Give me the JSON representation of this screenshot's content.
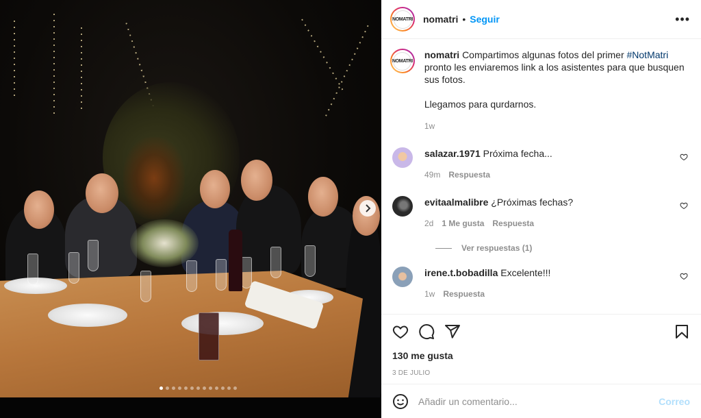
{
  "header": {
    "username": "nomatri",
    "separator": "•",
    "follow_label": "Seguir",
    "more_label": "•••",
    "avatar_text": "NOMATRI"
  },
  "caption": {
    "username": "nomatri",
    "text_before": "Compartimos algunas fotos del primer",
    "hashtag": "#NotMatri",
    "text_after": "pronto les enviaremos link a los asistentes para que busquen sus fotos.",
    "line2": "Llegamos para qurdarnos.",
    "time": "1w"
  },
  "comments": [
    {
      "username": "salazar.1971",
      "text": "Próxima fecha...",
      "time": "49m",
      "likes": "",
      "reply": "Respuesta",
      "avatar_color": "#c9b8e8"
    },
    {
      "username": "evitaalmalibre",
      "text": "¿Próximas fechas?",
      "time": "2d",
      "likes": "1 Me gusta",
      "reply": "Respuesta",
      "avatar_color": "#3a3a3a"
    },
    {
      "username": "irene.t.bobadilla",
      "text": "Excelente!!!",
      "time": "1w",
      "likes": "",
      "reply": "Respuesta",
      "avatar_color": "#8aa0b8"
    }
  ],
  "view_replies_label": "Ver respuestas (1)",
  "likes_count": "130 me gusta",
  "post_date": "3 DE JULIO",
  "add_comment": {
    "placeholder": "Añadir un comentario...",
    "post_label": "Correo"
  },
  "carousel": {
    "total": 13,
    "active_index": 0,
    "next_icon": "chevron-right-icon"
  },
  "icons": [
    "more-options-icon",
    "heart-icon",
    "comment-icon",
    "share-icon",
    "bookmark-icon",
    "emoji-icon"
  ]
}
